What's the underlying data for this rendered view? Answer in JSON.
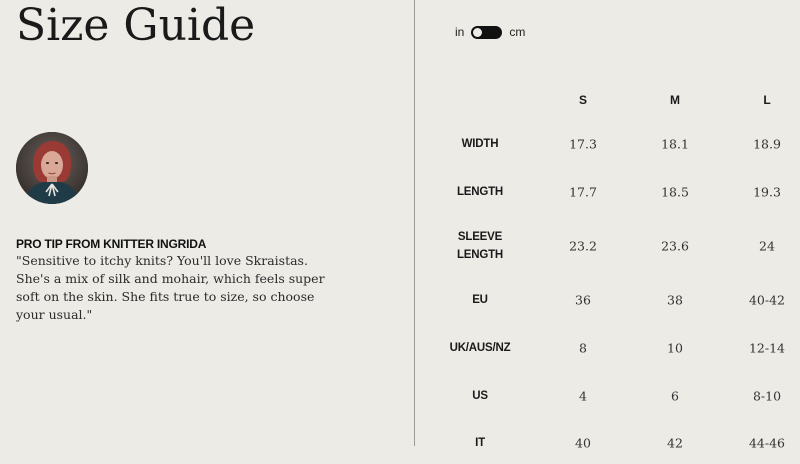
{
  "page": {
    "title": "Size Guide"
  },
  "tip": {
    "heading": "PRO TIP FROM KNITTER INGRIDA",
    "body": "\"Sensitive to itchy knits? You'll love Skraistas. She's a mix of silk and mohair, which feels super soft on the skin. She fits true to size, so choose your usual.\"",
    "avatar_icon": "knitter-portrait"
  },
  "unit_toggle": {
    "left_label": "in",
    "right_label": "cm",
    "selected": "in"
  },
  "table": {
    "columns": [
      "S",
      "M",
      "L"
    ],
    "rows": [
      {
        "label": "WIDTH",
        "values": [
          "17.3",
          "18.1",
          "18.9"
        ]
      },
      {
        "label": "LENGTH",
        "values": [
          "17.7",
          "18.5",
          "19.3"
        ]
      },
      {
        "label": "SLEEVE\nLENGTH",
        "values": [
          "23.2",
          "23.6",
          "24"
        ]
      },
      {
        "label": "EU",
        "values": [
          "36",
          "38",
          "40-42"
        ]
      },
      {
        "label": "UK/AUS/NZ",
        "values": [
          "8",
          "10",
          "12-14"
        ]
      },
      {
        "label": "US",
        "values": [
          "4",
          "6",
          "8-10"
        ]
      },
      {
        "label": "IT",
        "values": [
          "40",
          "42",
          "44-46"
        ]
      }
    ]
  },
  "colors": {
    "background": "#ecebe6",
    "text": "#1a1a1a",
    "divider": "#9a9a96",
    "toggle": "#111111"
  }
}
